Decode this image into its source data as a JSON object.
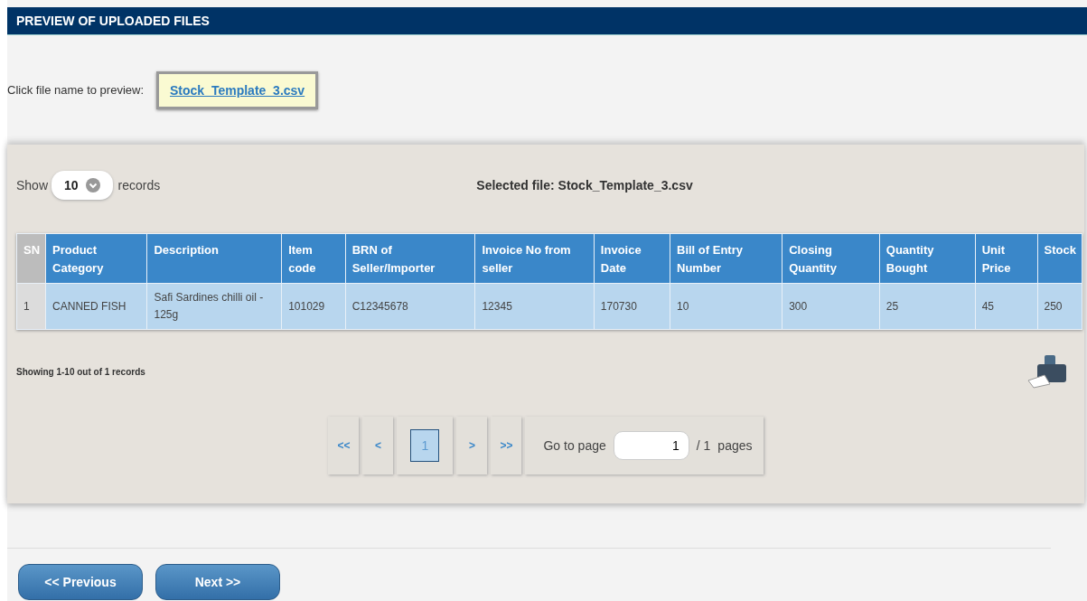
{
  "header": {
    "title": "PREVIEW OF UPLOADED FILES"
  },
  "file_picker": {
    "label": "Click file name to preview:",
    "files": [
      {
        "name": "Stock_Template_3.csv",
        "selected": true
      }
    ]
  },
  "records_control": {
    "prefix": "Show",
    "value": "10",
    "suffix": "records"
  },
  "selected_file": "Selected file: Stock_Template_3.csv",
  "table": {
    "columns": [
      "SN",
      "Product Category",
      "Description",
      "Item code",
      "BRN of Seller/Importer",
      "Invoice No from seller",
      "Invoice Date",
      "Bill of Entry Number",
      "Closing Quantity",
      "Quantity Bought",
      "Unit Price",
      "Stock"
    ],
    "rows": [
      [
        "1",
        "CANNED FISH",
        "Safi Sardines chilli oil - 125g",
        "101029",
        "C12345678",
        "12345",
        "170730",
        "10",
        "300",
        "25",
        "45",
        "250"
      ]
    ]
  },
  "summary": "Showing 1-10 out of 1 records",
  "pagination": {
    "first": "<<",
    "prev": "<",
    "pages": [
      {
        "label": "1",
        "selected": true
      }
    ],
    "next": ">",
    "last": ">>",
    "goto_label": "Go to page",
    "goto_value": "1",
    "total": "/ 1",
    "total_suffix": "pages"
  },
  "buttons": [
    "<< Previous",
    "Next >>"
  ]
}
